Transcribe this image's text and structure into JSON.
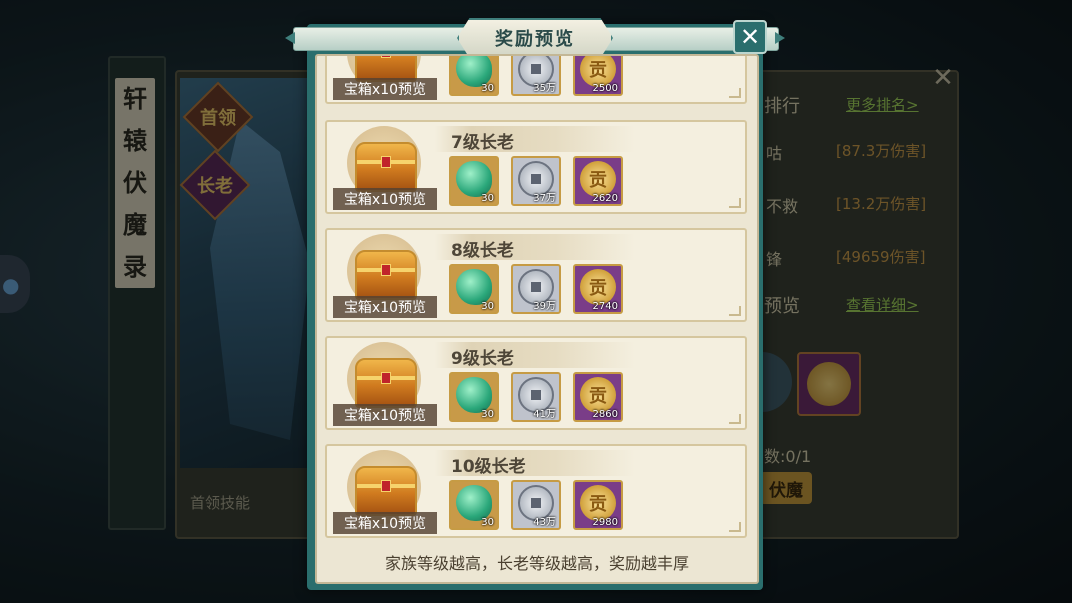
{
  "background": {
    "title_chars": [
      "轩",
      "辕",
      "伏",
      "魔",
      "录"
    ],
    "badge_first": "首领",
    "badge_elder": "长老",
    "ranking_label": "排行",
    "more_ranking_link": "更多排名>",
    "rank_rows": [
      {
        "name": "咕",
        "damage": "[87.3万伤害]"
      },
      {
        "name": "不救",
        "damage": "[13.2万伤害]"
      },
      {
        "name": "锋",
        "damage": "[49659伤害]"
      }
    ],
    "preview_label": "预览",
    "view_detail_link": "查看详细>",
    "count_label": "数:0/1",
    "action_button": "伏魔",
    "skill_label": "首领技能"
  },
  "modal": {
    "title": "奖励预览",
    "close_icon": "close-icon",
    "footer_note": "家族等级越高，长老等级越高，奖励越丰厚",
    "chest_label": "宝箱x10预览",
    "rows": [
      {
        "level": "",
        "jade_qty": "30",
        "copper_qty": "35万",
        "tribute_qty": "2500"
      },
      {
        "level": "7级长老",
        "jade_qty": "30",
        "copper_qty": "37万",
        "tribute_qty": "2620"
      },
      {
        "level": "8级长老",
        "jade_qty": "30",
        "copper_qty": "39万",
        "tribute_qty": "2740"
      },
      {
        "level": "9级长老",
        "jade_qty": "30",
        "copper_qty": "41万",
        "tribute_qty": "2860"
      },
      {
        "level": "10级长老",
        "jade_qty": "30",
        "copper_qty": "43万",
        "tribute_qty": "2980"
      }
    ]
  }
}
